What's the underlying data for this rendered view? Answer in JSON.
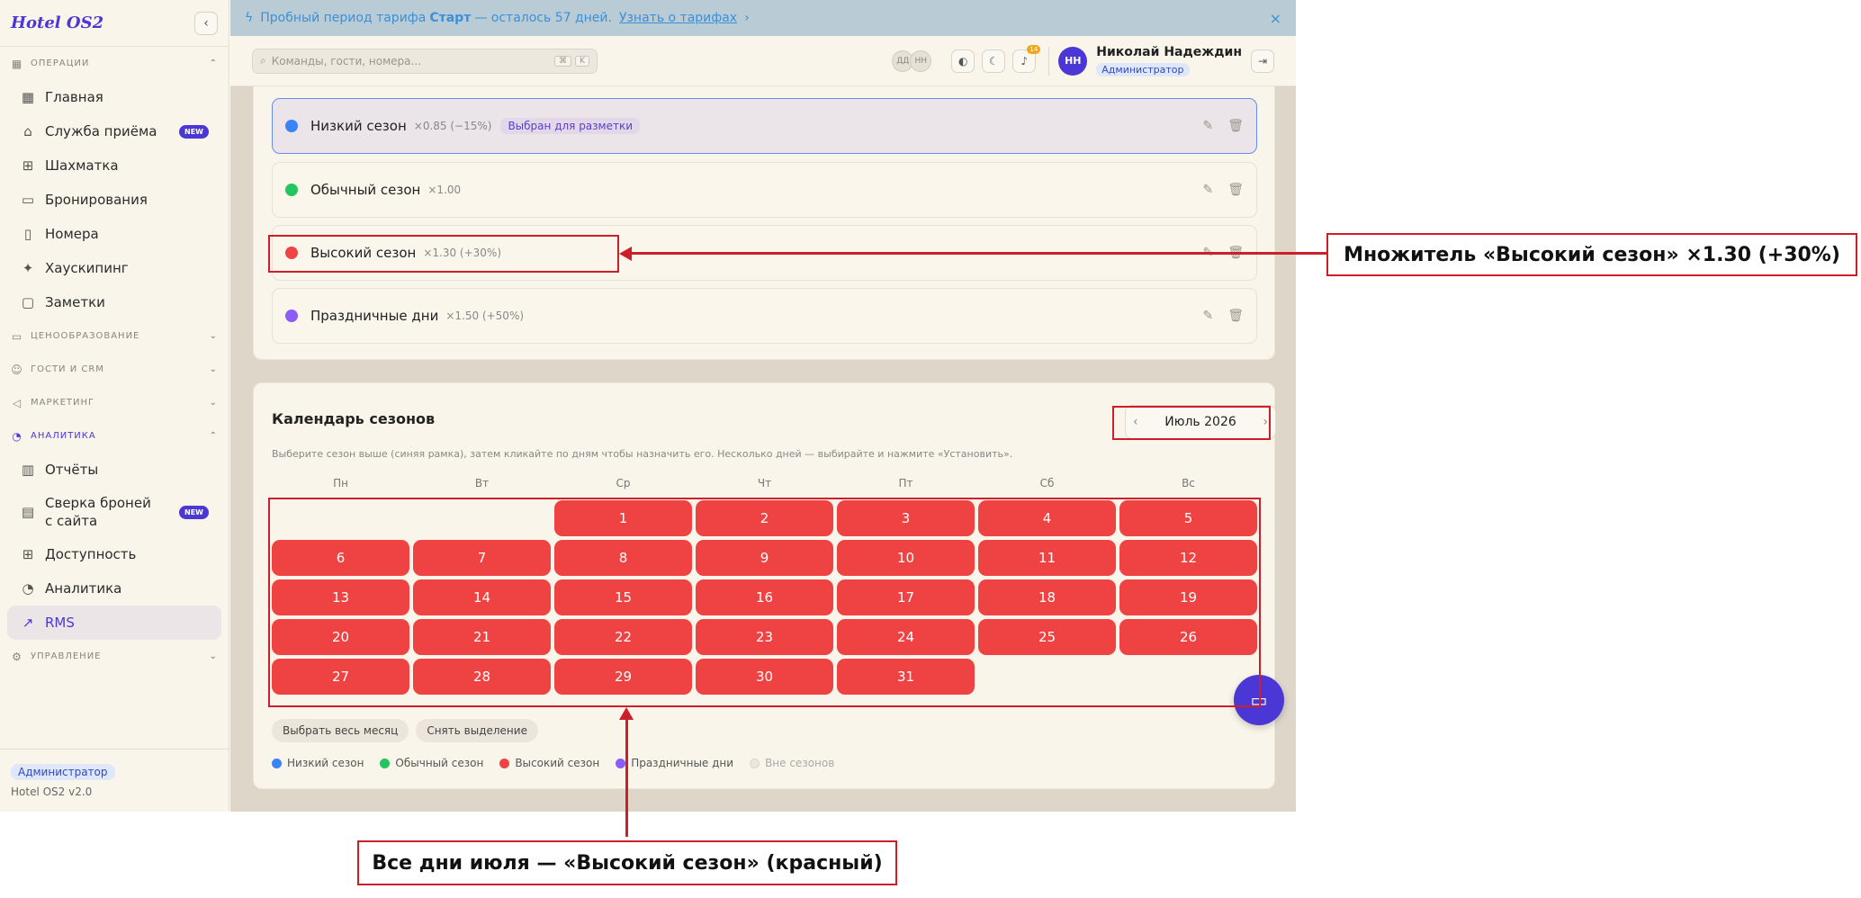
{
  "sidebar": {
    "logo": "Hotel OS2",
    "sections": {
      "operations": "ОПЕРАЦИИ",
      "pricing": "ЦЕНООБРАЗОВАНИЕ",
      "guests": "ГОСТИ И CRM",
      "marketing": "МАРКЕТИНГ",
      "analytics": "АНАЛИТИКА",
      "management": "УПРАВЛЕНИЕ"
    },
    "ops_items": [
      {
        "label": "Главная",
        "icon": "dashboard-icon"
      },
      {
        "label": "Служба приёма",
        "icon": "bell-desk-icon",
        "badge": "NEW"
      },
      {
        "label": "Шахматка",
        "icon": "grid-icon"
      },
      {
        "label": "Бронирования",
        "icon": "calendar-icon"
      },
      {
        "label": "Номера",
        "icon": "building-icon"
      },
      {
        "label": "Хаускипинг",
        "icon": "sparkle-icon"
      },
      {
        "label": "Заметки",
        "icon": "note-icon"
      }
    ],
    "analytics_items": [
      {
        "label": "Отчёты",
        "icon": "bar-chart-icon"
      },
      {
        "label": "Сверка броней с сайта",
        "icon": "document-icon",
        "badge": "NEW"
      },
      {
        "label": "Доступность",
        "icon": "grid-icon"
      },
      {
        "label": "Аналитика",
        "icon": "pie-icon"
      },
      {
        "label": "RMS",
        "icon": "trend-icon"
      }
    ],
    "footer": {
      "role": "Администратор",
      "version": "Hotel OS2 v2.0"
    }
  },
  "trial": {
    "text_before": "Пробный период тарифа",
    "plan": "Старт",
    "text_after": "— осталось 57 дней.",
    "link": "Узнать о тарифах",
    "arrow": "›",
    "close": "×"
  },
  "topbar": {
    "search_placeholder": "Команды, гости, номера...",
    "kb1": "⌘",
    "kb2": "K",
    "presence": [
      "ДД",
      "НН"
    ],
    "notif_count": "14",
    "user_initials": "НН",
    "user_name": "Николай Надеждин",
    "user_role": "Администратор"
  },
  "seasons": [
    {
      "name": "Низкий сезон",
      "mult": "×0.85 (−15%)",
      "color": "#3b82f6",
      "tag": "Выбран для разметки"
    },
    {
      "name": "Обычный сезон",
      "mult": "×1.00",
      "color": "#22c55e"
    },
    {
      "name": "Высокий сезон",
      "mult": "×1.30 (+30%)",
      "color": "#ef4444"
    },
    {
      "name": "Праздничные дни",
      "mult": "×1.50 (+50%)",
      "color": "#8b5cf6"
    }
  ],
  "calendar": {
    "title": "Календарь сезонов",
    "month": "Июль 2026",
    "prev": "‹",
    "next": "›",
    "hint": "Выберите сезон выше (синяя рамка), затем кликайте по дням чтобы назначить его. Несколько дней — выбирайте и нажмите «Установить».",
    "weekdays": [
      "Пн",
      "Вт",
      "Ср",
      "Чт",
      "Пт",
      "Сб",
      "Вс"
    ],
    "leading_empty": 2,
    "days": [
      "1",
      "2",
      "3",
      "4",
      "5",
      "6",
      "7",
      "8",
      "9",
      "10",
      "11",
      "12",
      "13",
      "14",
      "15",
      "16",
      "17",
      "18",
      "19",
      "20",
      "21",
      "22",
      "23",
      "24",
      "25",
      "26",
      "27",
      "28",
      "29",
      "30",
      "31"
    ],
    "day_color": "#ef4343",
    "btn_select_all": "Выбрать весь месяц",
    "btn_clear": "Снять выделение",
    "legend": [
      {
        "label": "Низкий сезон",
        "color": "#3b82f6"
      },
      {
        "label": "Обычный сезон",
        "color": "#22c55e"
      },
      {
        "label": "Высокий сезон",
        "color": "#ef4444"
      },
      {
        "label": "Праздничные дни",
        "color": "#8b5cf6"
      },
      {
        "label": "Вне сезонов",
        "color": "#ece7dc"
      }
    ]
  },
  "annotations": {
    "multiplier": "Множитель «Высокий сезон» ×1.30 (+30%)",
    "days": "Все дни июля — «Высокий сезон» (красный)"
  }
}
